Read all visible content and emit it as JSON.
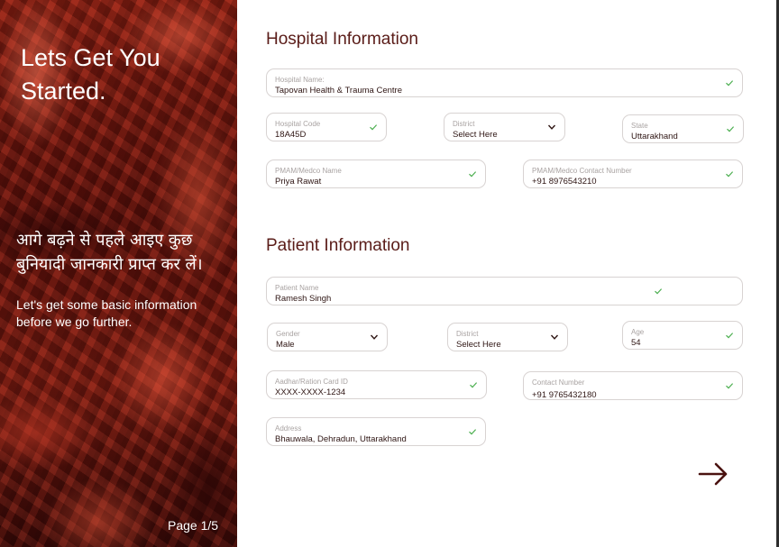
{
  "sidebar": {
    "title": "Lets Get You Started.",
    "hindi": "आगे बढ़ने से पहले आइए कुछ बुनियादी जानकारी प्राप्त कर लें।",
    "subtitle": "Let's get some basic information before we go further.",
    "page": "Page 1/5"
  },
  "hospital": {
    "title": "Hospital Information",
    "name": {
      "label": "Hospital Name:",
      "value": "Tapovan Health & Trauma Centre"
    },
    "code": {
      "label": "Hospital Code",
      "value": "18A45D"
    },
    "district": {
      "label": "District",
      "value": "Select Here"
    },
    "state": {
      "label": "State",
      "value": "Uttarakhand"
    },
    "pmam_name": {
      "label": "PMAM/Medco Name",
      "value": "Priya Rawat"
    },
    "pmam_contact": {
      "label": "PMAM/Medco Contact Number",
      "value": "+91 8976543210"
    }
  },
  "patient": {
    "title": "Patient Information",
    "name": {
      "label": "Patient Name",
      "value": "Ramesh Singh"
    },
    "gender": {
      "label": "Gender",
      "value": "Male"
    },
    "district": {
      "label": "District",
      "value": "Select Here"
    },
    "age": {
      "label": "Age",
      "value": "54"
    },
    "aadhar": {
      "label": "Aadhar/Ration Card ID",
      "value": "XXXX-XXXX-1234"
    },
    "contact": {
      "label": "Contact Number",
      "value": "+91 9765432180"
    },
    "address": {
      "label": "Address",
      "value": "Bhauwala, Dehradun, Uttarakhand"
    }
  },
  "colors": {
    "accent": "#5a1c18",
    "check": "#4caf50",
    "border": "#d8d3d2"
  },
  "icons": {
    "check": "check-icon",
    "chevron": "chevron-down-icon",
    "next": "arrow-right-icon"
  }
}
